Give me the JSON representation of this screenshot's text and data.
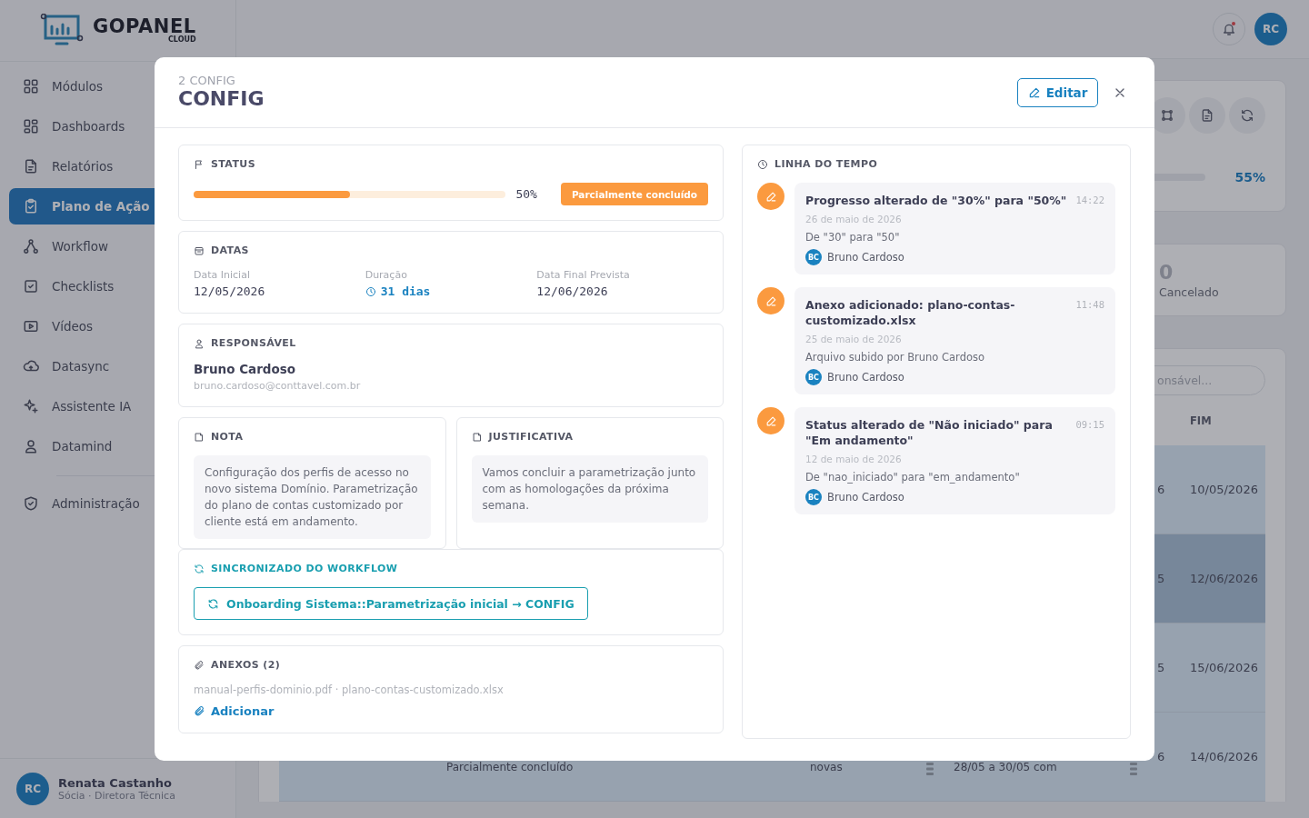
{
  "brand": {
    "name": "**GO**PANEL",
    "sub": "CLOUD"
  },
  "sidebar": {
    "items": [
      {
        "label": "Módulos",
        "selected": false
      },
      {
        "label": "Dashboards",
        "selected": false
      },
      {
        "label": "Relatórios",
        "selected": false
      },
      {
        "label": "Plano de Ação",
        "selected": true
      },
      {
        "label": "Workflow",
        "selected": false
      },
      {
        "label": "Checklists",
        "selected": false
      },
      {
        "label": "Vídeos",
        "selected": false
      },
      {
        "label": "Datasync",
        "selected": false
      },
      {
        "label": "Assistente IA",
        "selected": false
      },
      {
        "label": "Datamind",
        "selected": false
      }
    ],
    "admin_items": [
      {
        "label": "Administração",
        "selected": false
      }
    ]
  },
  "user": {
    "initials": "RC",
    "name": "Renata Castanho",
    "role": "Sócia · Diretora Técnica"
  },
  "header": {
    "unread": true,
    "avatar": "RC"
  },
  "summary": {
    "reading": "55%"
  },
  "stat": {
    "value": "0",
    "label": "Cancelado"
  },
  "search": {
    "placeholder": "onsável..."
  },
  "table": {
    "columns": [
      "FIM"
    ],
    "rows": [
      {
        "start_tail": "6",
        "end": "10/05/2026",
        "selected": false
      },
      {
        "start_tail": "5",
        "end": "12/06/2026",
        "selected": true
      },
      {
        "start_tail": "5",
        "end": "15/06/2026",
        "selected": false
      },
      {
        "start_tail": "6",
        "end": "14/06/2026",
        "selected": false,
        "progress": "Parcialmente concluído",
        "description": "novas",
        "period": "28/05 a 30/05 com"
      }
    ]
  },
  "modal": {
    "subtitle": "2 CONFIG",
    "title": "CONFIG",
    "edit": "Editar",
    "status": {
      "heading": "STATUS",
      "level": 0.5,
      "reading": "50%",
      "badge": "Parcialmente concluído"
    },
    "dates": {
      "heading": "DATAS",
      "fields": [
        {
          "label": "Data Inicial",
          "value": "12/05/2026",
          "kind": "date"
        },
        {
          "label": "Duração",
          "value": "31 dias",
          "kind": "duration"
        },
        {
          "label": "Data Final Prevista",
          "value": "12/06/2026",
          "kind": "date"
        }
      ]
    },
    "responsible": {
      "heading": "RESPONSÁVEL",
      "name": "Bruno Cardoso",
      "email": "bruno.cardoso@conttavel.com.br"
    },
    "note": {
      "heading": "NOTA",
      "text": "Configuração dos perfis de acesso no novo sistema Domínio. Parametrização do plano de contas customizado por cliente está em andamento."
    },
    "justification": {
      "heading": "JUSTIFICATIVA",
      "text": "Vamos concluir a parametrização junto com as homologações da próxima semana."
    },
    "workflow": {
      "heading": "SINCRONIZADO DO WORKFLOW",
      "link": "Onboarding Sistema::Parametrização inicial → CONFIG"
    },
    "attachments": {
      "heading": "ANEXOS (2)",
      "files": "manual-perfis-dominio.pdf · plano-contas-customizado.xlsx",
      "add": "Adicionar"
    },
    "timeline": {
      "heading": "LINHA DO TEMPO",
      "events": [
        {
          "title": "Progresso alterado de \"30%\" para \"50%\"",
          "time": "14:22",
          "date": "26 de maio de 2026",
          "detail": "De \"30\" para \"50\"",
          "initials": "BC",
          "author": "Bruno Cardoso"
        },
        {
          "title": "Anexo adicionado: plano-contas-customizado.xlsx",
          "time": "11:48",
          "date": "25 de maio de 2026",
          "detail": "Arquivo subido por Bruno Cardoso",
          "initials": "BC",
          "author": "Bruno Cardoso"
        },
        {
          "title": "Status alterado de \"Não iniciado\" para \"Em andamento\"",
          "time": "09:15",
          "date": "12 de maio de 2026",
          "detail": "De \"nao_iniciado\" para \"em_andamento\"",
          "initials": "BC",
          "author": "Bruno Cardoso"
        }
      ]
    }
  }
}
